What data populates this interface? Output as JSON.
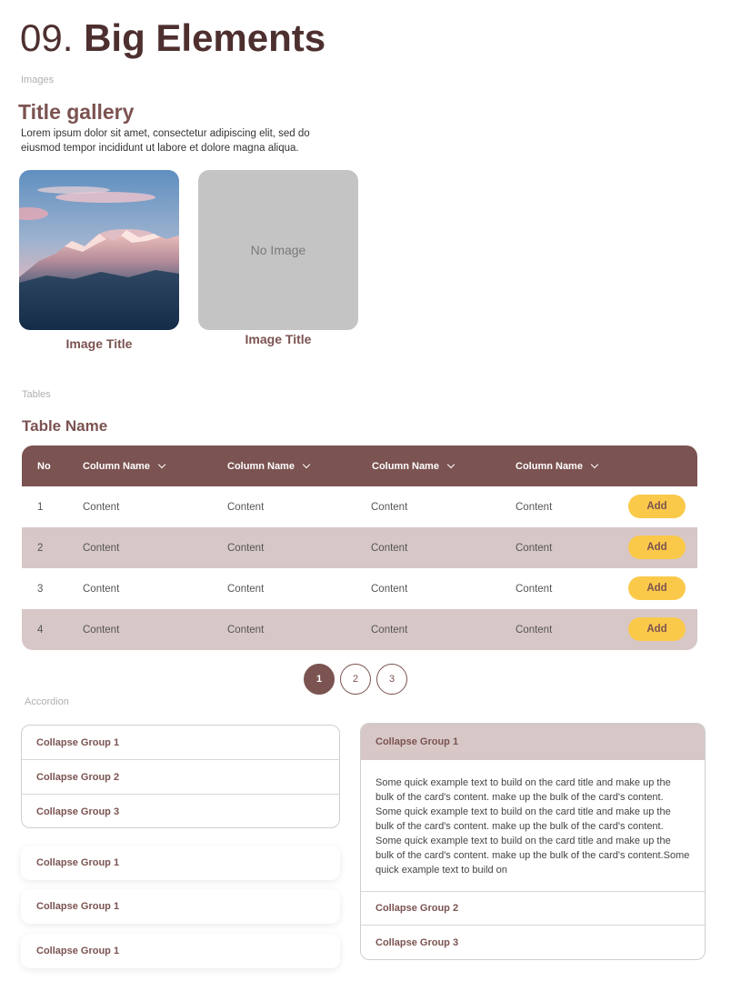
{
  "header": {
    "number": "09.",
    "title": "Big Elements"
  },
  "sections": {
    "images": "Images",
    "tables": "Tables",
    "accordion": "Accordion"
  },
  "gallery": {
    "title": "Title gallery",
    "description": "Lorem ipsum dolor sit amet, consectetur adipiscing elit, sed do eiusmod tempor incididunt ut labore et dolore magna aliqua.",
    "items": [
      {
        "caption": "Image Title"
      },
      {
        "caption": "Image Title",
        "placeholder": "No Image"
      }
    ]
  },
  "table": {
    "name": "Table Name",
    "columns": [
      "No",
      "Column Name",
      "Column Name",
      "Column Name",
      "Column Name"
    ],
    "rows": [
      {
        "no": "1",
        "cells": [
          "Content",
          "Content",
          "Content",
          "Content"
        ],
        "action": "Add"
      },
      {
        "no": "2",
        "cells": [
          "Content",
          "Content",
          "Content",
          "Content"
        ],
        "action": "Add"
      },
      {
        "no": "3",
        "cells": [
          "Content",
          "Content",
          "Content",
          "Content"
        ],
        "action": "Add"
      },
      {
        "no": "4",
        "cells": [
          "Content",
          "Content",
          "Content",
          "Content"
        ],
        "action": "Add"
      }
    ]
  },
  "pagination": {
    "pages": [
      "1",
      "2",
      "3"
    ],
    "active": "1"
  },
  "accordion_left": {
    "group": [
      "Collapse Group 1",
      "Collapse Group 2",
      "Collapse Group 3"
    ],
    "cards": [
      "Collapse Group 1",
      "Collapse Group 1",
      "Collapse Group 1"
    ]
  },
  "accordion_right": {
    "open_title": "Collapse Group 1",
    "body": "Some quick example text to build on the card title and make up the bulk of the card's content.  make up the bulk of the card's content. Some quick example text to build on the card title and make up the bulk of the card's content.  make up the bulk of the card's content. Some quick example text to build on the card title and make up the bulk of the card's content.  make up the bulk of the card's content.Some quick example text to build on",
    "items": [
      "Collapse Group 2",
      "Collapse Group 3"
    ]
  },
  "colors": {
    "primary": "#7b5351",
    "accent": "#fbc94a",
    "row_alt": "#d7c7c7",
    "placeholder": "#c4c4c4"
  }
}
